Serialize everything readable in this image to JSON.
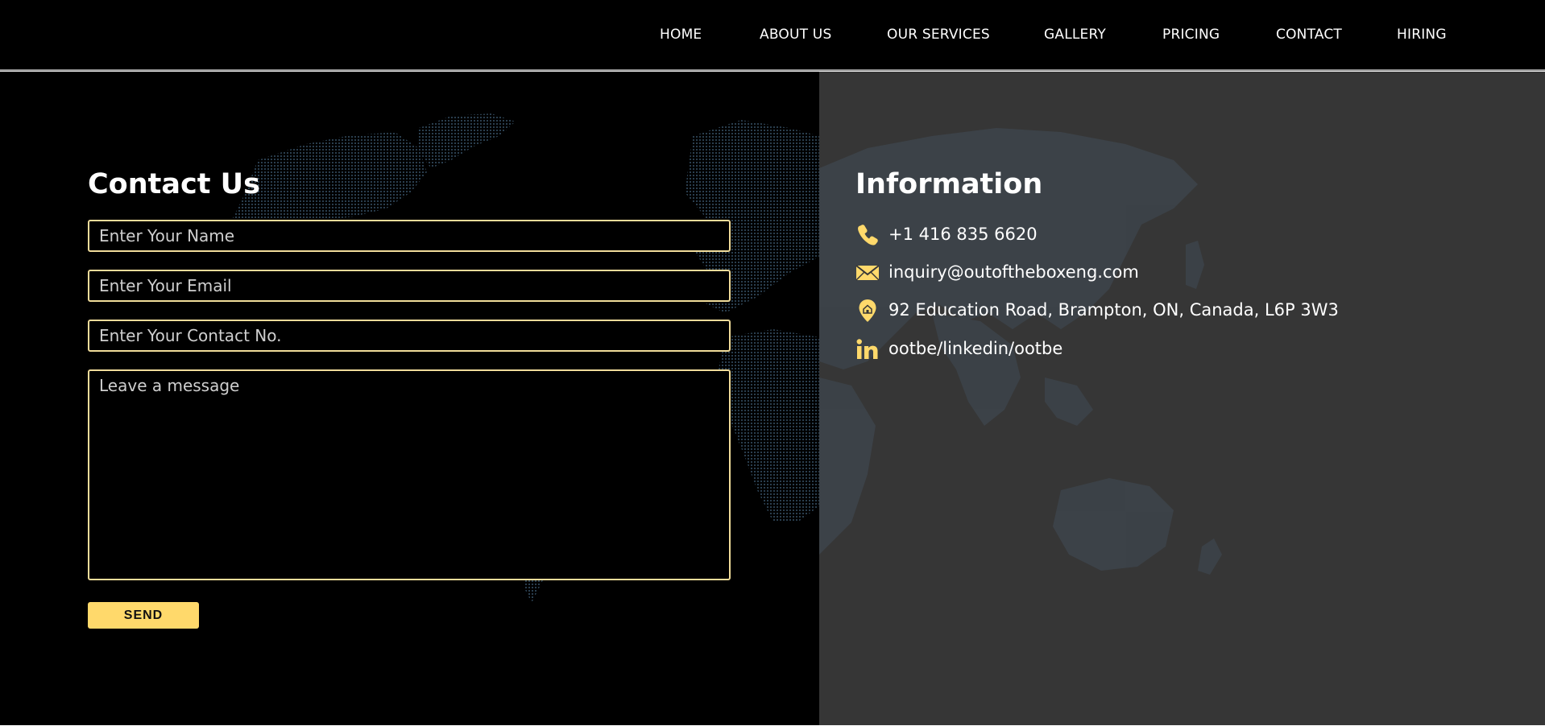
{
  "nav": {
    "items": [
      {
        "label": "HOME"
      },
      {
        "label": "ABOUT US"
      },
      {
        "label": "OUR SERVICES"
      },
      {
        "label": "GALLERY"
      },
      {
        "label": "PRICING"
      },
      {
        "label": "CONTACT"
      },
      {
        "label": "HIRING"
      }
    ]
  },
  "form": {
    "title": "Contact Us",
    "name_placeholder": "Enter Your Name",
    "email_placeholder": "Enter Your Email",
    "contact_placeholder": "Enter Your Contact No.",
    "message_placeholder": "Leave a message",
    "send_label": "SEND"
  },
  "info": {
    "title": "Information",
    "phone": {
      "icon": "phone-icon",
      "text": "+1 416 835 6620"
    },
    "email": {
      "icon": "envelope-icon",
      "text": "inquiry@outoftheboxeng.com"
    },
    "address": {
      "icon": "location-pin-icon",
      "text": "92 Education Road, Brampton, ON, Canada, L6P 3W3"
    },
    "linkedin": {
      "icon": "linkedin-icon",
      "text": "ootbe/linkedin/ootbe"
    }
  },
  "colors": {
    "accent": "#ffd96b",
    "field_border": "#f0dc9a",
    "left_background": "#000000",
    "right_background": "#363636",
    "map_dots": "#2f4557"
  }
}
